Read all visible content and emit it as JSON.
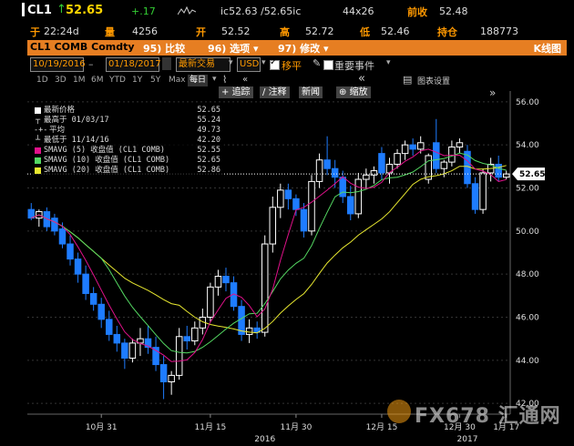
{
  "quote": {
    "ticker": "CL1",
    "last": "52.65",
    "change": "+.17",
    "bid_ask": "ic52.63 /52.65ic",
    "size": "44x26",
    "prev_close_label": "前收",
    "prev_close": "52.48"
  },
  "quote2": {
    "time_label": "于",
    "time": "22:24d",
    "volume_label": "量",
    "volume": "4256",
    "open_label": "开",
    "open": "52.52",
    "high_label": "高",
    "high": "52.72",
    "low_label": "低",
    "low": "52.46",
    "oi_label": "持仓",
    "oi": "188773"
  },
  "toolbar": {
    "security": "CL1 COMB Comdty",
    "compare": "95) 比较",
    "options": "96) 选项 ▾",
    "edit": "97) 修改 ▾",
    "chart_type": "K线图"
  },
  "controls": {
    "start_date": "10/19/2016",
    "end_date": "01/18/2017",
    "period": "最新交易",
    "currency": "USD",
    "smooth_label": "移平",
    "events_label": "重要事件"
  },
  "periods": [
    "1D",
    "3D",
    "1M",
    "6M",
    "YTD",
    "1Y",
    "5Y",
    "Max",
    "每日"
  ],
  "nav": {
    "track": "追踪",
    "annotate": "注释",
    "news": "新闻",
    "zoom": "缩放"
  },
  "legend": {
    "last_price": {
      "label": "最新价格",
      "value": "52.65"
    },
    "high": {
      "label": "最高于 01/03/17",
      "value": "55.24"
    },
    "avg": {
      "label": "平均",
      "value": "49.73"
    },
    "low": {
      "label": "最低于 11/14/16",
      "value": "42.20"
    },
    "sma5": {
      "label": "SMAVG (5) 收盘值 (CL1 COMB)",
      "value": "52.55"
    },
    "sma10": {
      "label": "SMAVG (10) 收盘值 (CL1 COMB)",
      "value": "52.65"
    },
    "sma20": {
      "label": "SMAVG (20) 收盘值 (CL1 COMB)",
      "value": "52.86"
    }
  },
  "watermark": "FX678 汇通网",
  "colors": {
    "up": "#ffffff",
    "down": "#1e7cff",
    "sma5": "#e0118a",
    "sma10": "#54d862",
    "sma20": "#e8e830",
    "orange": "#e67e22",
    "price_tag": "#ffffff"
  },
  "chart_data": {
    "type": "candlestick",
    "ylim": [
      41.5,
      56.5
    ],
    "y_ticks": [
      "42.00",
      "44.00",
      "46.00",
      "48.00",
      "50.00",
      "52.00",
      "54.00",
      "56.00"
    ],
    "x_labels": [
      "10月 31",
      "11月 15",
      "11月 30",
      "12月 15",
      "12月 30",
      "1月 17"
    ],
    "year_labels": [
      "2016",
      "2017"
    ],
    "current_price": "52.65",
    "candles": [
      {
        "o": 51.0,
        "h": 51.3,
        "l": 50.5,
        "c": 50.6
      },
      {
        "o": 50.6,
        "h": 51.0,
        "l": 50.2,
        "c": 50.9
      },
      {
        "o": 50.9,
        "h": 51.1,
        "l": 50.0,
        "c": 50.2
      },
      {
        "o": 50.6,
        "h": 50.8,
        "l": 49.8,
        "c": 50.0
      },
      {
        "o": 50.1,
        "h": 50.4,
        "l": 49.2,
        "c": 49.4
      },
      {
        "o": 49.4,
        "h": 49.8,
        "l": 48.4,
        "c": 48.7
      },
      {
        "o": 48.7,
        "h": 49.0,
        "l": 47.6,
        "c": 48.0
      },
      {
        "o": 48.0,
        "h": 48.4,
        "l": 46.8,
        "c": 47.1
      },
      {
        "o": 47.1,
        "h": 47.4,
        "l": 46.3,
        "c": 46.6
      },
      {
        "o": 46.6,
        "h": 46.9,
        "l": 45.5,
        "c": 45.9
      },
      {
        "o": 45.9,
        "h": 46.3,
        "l": 44.9,
        "c": 45.2
      },
      {
        "o": 45.2,
        "h": 45.6,
        "l": 44.4,
        "c": 44.8
      },
      {
        "o": 44.8,
        "h": 45.0,
        "l": 43.6,
        "c": 44.1
      },
      {
        "o": 44.1,
        "h": 45.0,
        "l": 43.9,
        "c": 44.8
      },
      {
        "o": 44.8,
        "h": 45.5,
        "l": 44.2,
        "c": 45.0
      },
      {
        "o": 45.0,
        "h": 45.6,
        "l": 44.3,
        "c": 44.6
      },
      {
        "o": 44.6,
        "h": 45.1,
        "l": 43.5,
        "c": 43.8
      },
      {
        "o": 43.8,
        "h": 44.2,
        "l": 42.2,
        "c": 43.0
      },
      {
        "o": 43.0,
        "h": 43.5,
        "l": 42.4,
        "c": 43.3
      },
      {
        "o": 43.3,
        "h": 45.5,
        "l": 43.1,
        "c": 45.1
      },
      {
        "o": 45.1,
        "h": 45.6,
        "l": 44.5,
        "c": 44.9
      },
      {
        "o": 44.9,
        "h": 45.8,
        "l": 44.7,
        "c": 45.5
      },
      {
        "o": 45.5,
        "h": 46.4,
        "l": 45.2,
        "c": 46.0
      },
      {
        "o": 46.0,
        "h": 47.6,
        "l": 45.8,
        "c": 47.4
      },
      {
        "o": 47.4,
        "h": 48.2,
        "l": 47.0,
        "c": 47.9
      },
      {
        "o": 47.9,
        "h": 48.3,
        "l": 47.2,
        "c": 47.6
      },
      {
        "o": 47.6,
        "h": 47.9,
        "l": 46.3,
        "c": 46.5
      },
      {
        "o": 46.5,
        "h": 46.8,
        "l": 44.9,
        "c": 45.2
      },
      {
        "o": 45.2,
        "h": 45.9,
        "l": 44.8,
        "c": 45.5
      },
      {
        "o": 45.5,
        "h": 45.8,
        "l": 45.0,
        "c": 45.3
      },
      {
        "o": 45.3,
        "h": 49.8,
        "l": 45.1,
        "c": 49.4
      },
      {
        "o": 49.4,
        "h": 51.6,
        "l": 49.0,
        "c": 51.1
      },
      {
        "o": 51.1,
        "h": 52.2,
        "l": 50.6,
        "c": 51.9
      },
      {
        "o": 51.9,
        "h": 52.2,
        "l": 51.0,
        "c": 51.5
      },
      {
        "o": 51.5,
        "h": 51.7,
        "l": 50.7,
        "c": 51.0
      },
      {
        "o": 51.0,
        "h": 51.3,
        "l": 49.7,
        "c": 50.0
      },
      {
        "o": 50.0,
        "h": 52.6,
        "l": 49.8,
        "c": 52.3
      },
      {
        "o": 52.3,
        "h": 53.6,
        "l": 52.0,
        "c": 53.3
      },
      {
        "o": 53.3,
        "h": 54.4,
        "l": 52.6,
        "c": 52.9
      },
      {
        "o": 52.9,
        "h": 53.3,
        "l": 52.0,
        "c": 52.5
      },
      {
        "o": 52.5,
        "h": 52.8,
        "l": 51.3,
        "c": 51.6
      },
      {
        "o": 51.6,
        "h": 52.1,
        "l": 50.5,
        "c": 50.8
      },
      {
        "o": 50.8,
        "h": 52.7,
        "l": 50.6,
        "c": 52.4
      },
      {
        "o": 52.4,
        "h": 52.9,
        "l": 52.0,
        "c": 52.6
      },
      {
        "o": 52.6,
        "h": 53.0,
        "l": 52.2,
        "c": 52.8
      },
      {
        "o": 53.6,
        "h": 53.9,
        "l": 52.4,
        "c": 52.7
      },
      {
        "o": 52.7,
        "h": 53.4,
        "l": 52.2,
        "c": 53.1
      },
      {
        "o": 53.1,
        "h": 53.8,
        "l": 52.9,
        "c": 53.6
      },
      {
        "o": 53.6,
        "h": 54.2,
        "l": 53.3,
        "c": 54.0
      },
      {
        "o": 54.0,
        "h": 54.3,
        "l": 53.5,
        "c": 53.8
      },
      {
        "o": 53.8,
        "h": 54.4,
        "l": 53.6,
        "c": 54.1
      },
      {
        "o": 52.4,
        "h": 53.6,
        "l": 52.2,
        "c": 53.5
      },
      {
        "o": 54.1,
        "h": 55.2,
        "l": 52.7,
        "c": 52.9
      },
      {
        "o": 52.9,
        "h": 53.3,
        "l": 52.5,
        "c": 53.2
      },
      {
        "o": 53.2,
        "h": 54.2,
        "l": 53.0,
        "c": 53.9
      },
      {
        "o": 53.9,
        "h": 54.3,
        "l": 53.6,
        "c": 54.1
      },
      {
        "o": 53.7,
        "h": 54.0,
        "l": 52.0,
        "c": 52.2
      },
      {
        "o": 52.2,
        "h": 52.5,
        "l": 50.8,
        "c": 51.0
      },
      {
        "o": 51.0,
        "h": 52.9,
        "l": 50.8,
        "c": 52.7
      },
      {
        "o": 52.7,
        "h": 53.4,
        "l": 52.3,
        "c": 53.1
      },
      {
        "o": 53.1,
        "h": 53.5,
        "l": 52.3,
        "c": 52.5
      },
      {
        "o": 52.5,
        "h": 52.8,
        "l": 52.4,
        "c": 52.65
      }
    ]
  }
}
